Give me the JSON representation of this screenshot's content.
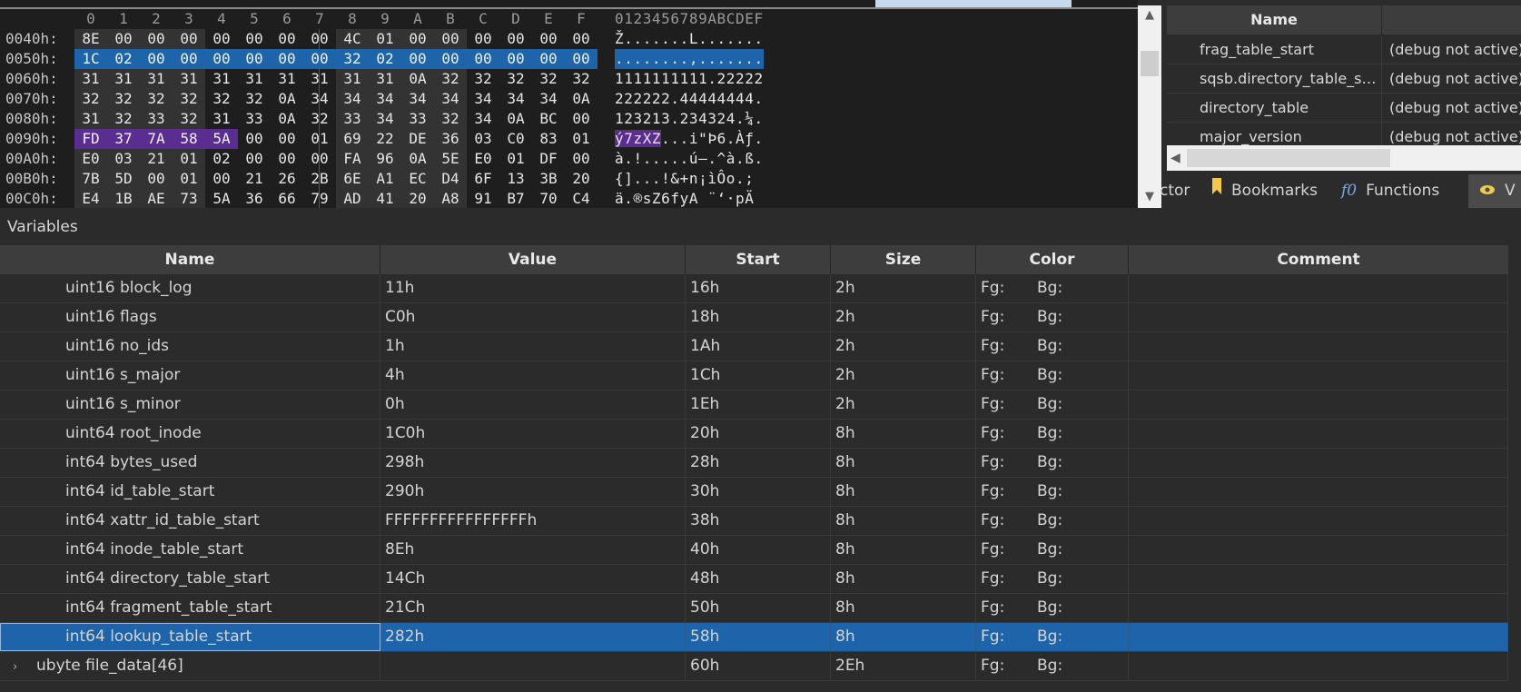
{
  "hex": {
    "column_headers": [
      "0",
      "1",
      "2",
      "3",
      "4",
      "5",
      "6",
      "7",
      "8",
      "9",
      "A",
      "B",
      "C",
      "D",
      "E",
      "F"
    ],
    "ascii_header": "0123456789ABCDEF",
    "rows": [
      {
        "offset": "0040h:",
        "bytes": [
          "8E",
          "00",
          "00",
          "00",
          "00",
          "00",
          "00",
          "00",
          "4C",
          "01",
          "00",
          "00",
          "00",
          "00",
          "00",
          "00"
        ],
        "ascii": "Ž.......L......."
      },
      {
        "offset": "0050h:",
        "bytes": [
          "1C",
          "02",
          "00",
          "00",
          "00",
          "00",
          "00",
          "00",
          "32",
          "02",
          "00",
          "00",
          "00",
          "00",
          "00",
          "00"
        ],
        "ascii": "........,.......",
        "selected": true
      },
      {
        "offset": "0060h:",
        "bytes": [
          "31",
          "31",
          "31",
          "31",
          "31",
          "31",
          "31",
          "31",
          "31",
          "31",
          "0A",
          "32",
          "32",
          "32",
          "32",
          "32"
        ],
        "ascii": "1111111111.22222"
      },
      {
        "offset": "0070h:",
        "bytes": [
          "32",
          "32",
          "32",
          "32",
          "32",
          "32",
          "0A",
          "34",
          "34",
          "34",
          "34",
          "34",
          "34",
          "34",
          "34",
          "0A"
        ],
        "ascii": "222222.44444444."
      },
      {
        "offset": "0080h:",
        "bytes": [
          "31",
          "32",
          "33",
          "32",
          "31",
          "33",
          "0A",
          "32",
          "33",
          "34",
          "33",
          "32",
          "34",
          "0A",
          "BC",
          "00"
        ],
        "ascii": "123213.234324.¼."
      },
      {
        "offset": "0090h:",
        "bytes": [
          "FD",
          "37",
          "7A",
          "58",
          "5A",
          "00",
          "00",
          "01",
          "69",
          "22",
          "DE",
          "36",
          "03",
          "C0",
          "83",
          "01"
        ],
        "ascii": "ý7zXZ...i\"Þ6.Àƒ.",
        "hl_count": 5
      },
      {
        "offset": "00A0h:",
        "bytes": [
          "E0",
          "03",
          "21",
          "01",
          "02",
          "00",
          "00",
          "00",
          "FA",
          "96",
          "0A",
          "5E",
          "E0",
          "01",
          "DF",
          "00"
        ],
        "ascii": "à.!.....ú–.^à.ß."
      },
      {
        "offset": "00B0h:",
        "bytes": [
          "7B",
          "5D",
          "00",
          "01",
          "00",
          "21",
          "26",
          "2B",
          "6E",
          "A1",
          "EC",
          "D4",
          "6F",
          "13",
          "3B",
          "20"
        ],
        "ascii": "{]...!&+n¡ìÔo.; "
      },
      {
        "offset": "00C0h:",
        "bytes": [
          "E4",
          "1B",
          "AE",
          "73",
          "5A",
          "36",
          "66",
          "79",
          "AD",
          "41",
          "20",
          "A8",
          "91",
          "B7",
          "70",
          "C4"
        ],
        "ascii": "ä.®sZ6fy­A ¨‘·pÄ"
      }
    ]
  },
  "right_panel": {
    "header_name": "Name",
    "rows": [
      {
        "name": "frag_table_start",
        "value": "(debug not active)"
      },
      {
        "name": "sqsb.directory_table_st...",
        "value": "(debug not active)"
      },
      {
        "name": "directory_table",
        "value": "(debug not active)"
      },
      {
        "name": "major_version",
        "value": "(debug not active)"
      }
    ],
    "tabs": [
      {
        "label": "ctor",
        "icon": ""
      },
      {
        "label": "Bookmarks",
        "icon": "bookmark-icon"
      },
      {
        "label": "Functions",
        "icon": "function-icon"
      },
      {
        "label": "V",
        "icon": "eye-icon"
      }
    ]
  },
  "variables": {
    "title": "Variables",
    "columns": {
      "name": "Name",
      "value": "Value",
      "start": "Start",
      "size": "Size",
      "color": "Color",
      "comment": "Comment"
    },
    "rows": [
      {
        "name": "uint16 block_log",
        "value": "11h",
        "start": "16h",
        "size": "2h",
        "fg": "Fg:",
        "bg": "Bg:",
        "comment": ""
      },
      {
        "name": "uint16 flags",
        "value": "C0h",
        "start": "18h",
        "size": "2h",
        "fg": "Fg:",
        "bg": "Bg:",
        "comment": ""
      },
      {
        "name": "uint16 no_ids",
        "value": "1h",
        "start": "1Ah",
        "size": "2h",
        "fg": "Fg:",
        "bg": "Bg:",
        "comment": ""
      },
      {
        "name": "uint16 s_major",
        "value": "4h",
        "start": "1Ch",
        "size": "2h",
        "fg": "Fg:",
        "bg": "Bg:",
        "comment": ""
      },
      {
        "name": "uint16 s_minor",
        "value": "0h",
        "start": "1Eh",
        "size": "2h",
        "fg": "Fg:",
        "bg": "Bg:",
        "comment": ""
      },
      {
        "name": "uint64 root_inode",
        "value": "1C0h",
        "start": "20h",
        "size": "8h",
        "fg": "Fg:",
        "bg": "Bg:",
        "comment": ""
      },
      {
        "name": "int64 bytes_used",
        "value": "298h",
        "start": "28h",
        "size": "8h",
        "fg": "Fg:",
        "bg": "Bg:",
        "comment": ""
      },
      {
        "name": "int64 id_table_start",
        "value": "290h",
        "start": "30h",
        "size": "8h",
        "fg": "Fg:",
        "bg": "Bg:",
        "comment": ""
      },
      {
        "name": "int64 xattr_id_table_start",
        "value": "FFFFFFFFFFFFFFFFh",
        "start": "38h",
        "size": "8h",
        "fg": "Fg:",
        "bg": "Bg:",
        "comment": ""
      },
      {
        "name": "int64 inode_table_start",
        "value": "8Eh",
        "start": "40h",
        "size": "8h",
        "fg": "Fg:",
        "bg": "Bg:",
        "comment": ""
      },
      {
        "name": "int64 directory_table_start",
        "value": "14Ch",
        "start": "48h",
        "size": "8h",
        "fg": "Fg:",
        "bg": "Bg:",
        "comment": ""
      },
      {
        "name": "int64 fragment_table_start",
        "value": "21Ch",
        "start": "50h",
        "size": "8h",
        "fg": "Fg:",
        "bg": "Bg:",
        "comment": ""
      },
      {
        "name": "int64 lookup_table_start",
        "value": "282h",
        "start": "58h",
        "size": "8h",
        "fg": "Fg:",
        "bg": "Bg:",
        "comment": "",
        "selected": true
      },
      {
        "name": "ubyte file_data[46]",
        "value": "",
        "start": "60h",
        "size": "2Eh",
        "fg": "Fg:",
        "bg": "Bg:",
        "comment": "",
        "expandable": true,
        "top_level": true
      }
    ]
  },
  "colors": {
    "selection": "#1e64aa",
    "highlight": "#5a2d91",
    "background": "#2b2b2b",
    "hex_background": "#1e1e1e"
  }
}
